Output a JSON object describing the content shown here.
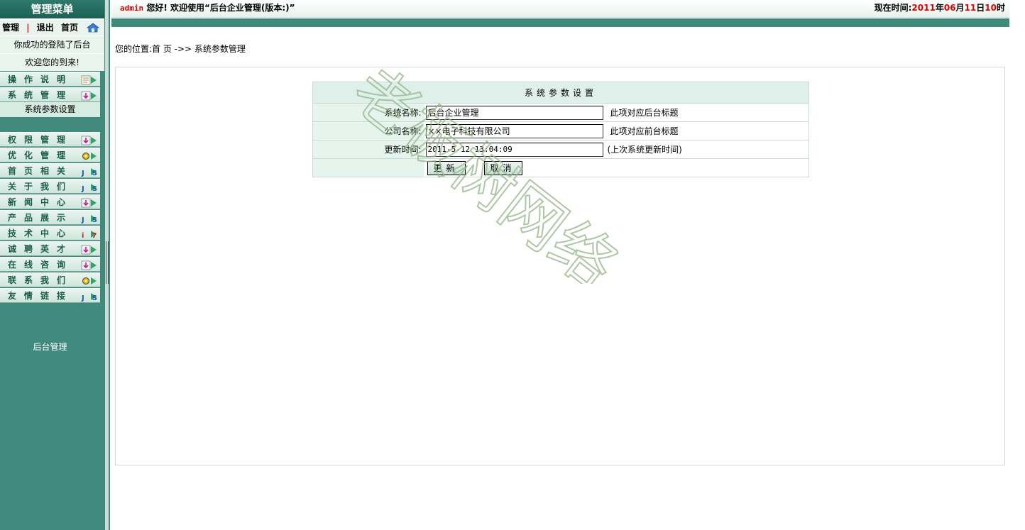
{
  "sidebar": {
    "title": "管理菜单",
    "links": {
      "manage": "管理",
      "separator": "|",
      "logout": "退出",
      "home": "首页"
    },
    "welcome1": "你成功的登陆了后台",
    "welcome2": "欢迎您的到来!",
    "menu": [
      {
        "label": "操作说明",
        "icon": "document-icon"
      },
      {
        "label": "系统管理",
        "icon": "download-icon"
      }
    ],
    "submenu": [
      "系统参数设置"
    ],
    "menu2": [
      {
        "label": "权限管理",
        "icon": "download-icon"
      },
      {
        "label": "优化管理",
        "icon": "gear-icon"
      },
      {
        "label": "首页相关",
        "icon": "js-icon"
      },
      {
        "label": "关于我们",
        "icon": "js-icon"
      },
      {
        "label": "新闻中心",
        "icon": "download-icon"
      },
      {
        "label": "产品展示",
        "icon": "js-icon"
      },
      {
        "label": "技术中心",
        "icon": "info-icon"
      },
      {
        "label": "诚聘英才",
        "icon": "download-icon"
      },
      {
        "label": "在线咨询",
        "icon": "download-icon"
      },
      {
        "label": "联系我们",
        "icon": "gear-icon"
      },
      {
        "label": "友情链接",
        "icon": "js-icon"
      }
    ],
    "footer": "后台管理"
  },
  "topbar": {
    "user": "admin",
    "greeting": "您好! 欢迎使用“后台企业管理(版本:)”",
    "time_prefix": "现在时间:",
    "year": "2011",
    "year_unit": "年",
    "month": "06",
    "month_unit": "月",
    "day": "11",
    "day_unit": "日",
    "hour": "10",
    "hour_unit": "时"
  },
  "breadcrumb": "您的位置:首 页 ->> 系统参数管理",
  "form": {
    "title": "系统参数设置",
    "rows": [
      {
        "label": "系统名称:",
        "value": "后台企业管理",
        "hint": "此项对应后台标题"
      },
      {
        "label": "公司名称:",
        "value": "××电子科技有限公司",
        "hint": "此项对应前台标题"
      },
      {
        "label": "更新时间:",
        "value": "2011-5-12 13:04:09",
        "hint": "(上次系统更新时间)"
      }
    ],
    "update_button": "更新",
    "cancel_button": "取消"
  },
  "watermark": "老板树网络",
  "colors": {
    "sidebar": "#3f8a7c",
    "accent_red": "#dd0000",
    "header_bg": "#dff0ea"
  }
}
